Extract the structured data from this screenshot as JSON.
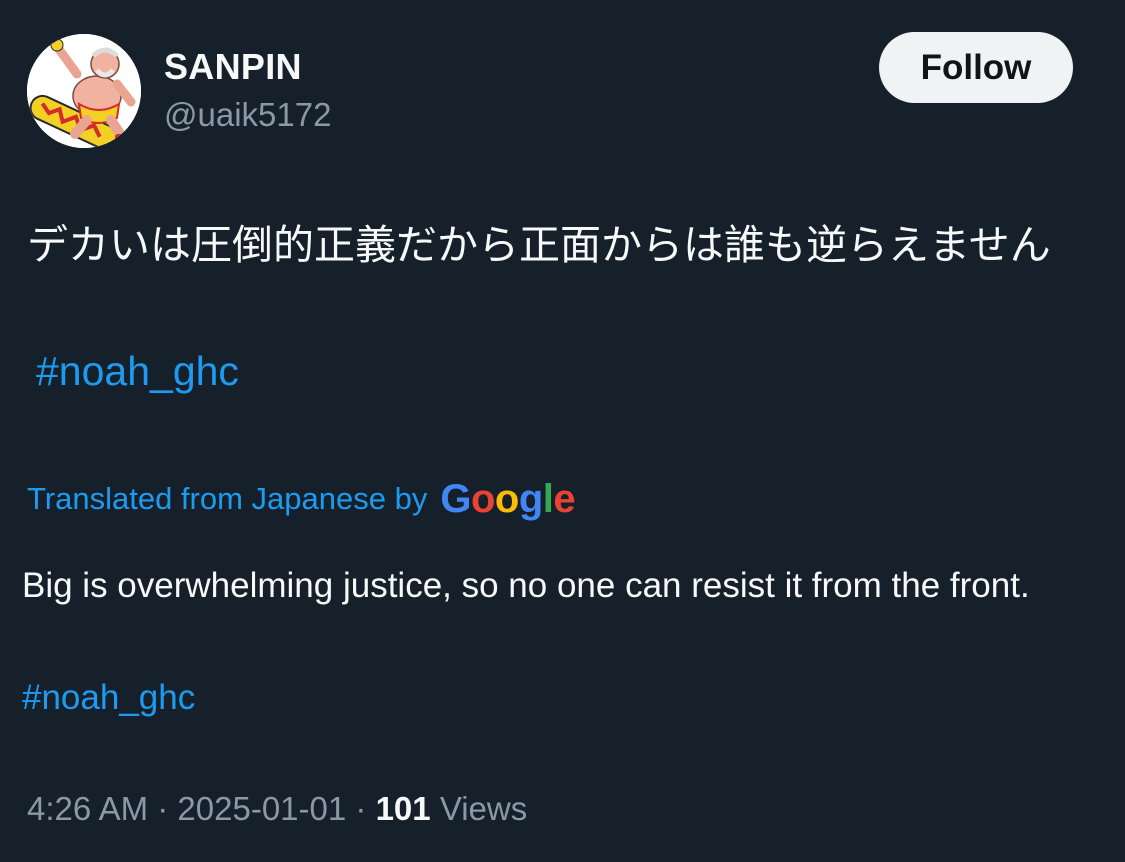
{
  "user": {
    "display_name": "SANPIN",
    "handle": "@uaik5172"
  },
  "follow_button": {
    "label": "Follow"
  },
  "tweet": {
    "original_text": "デカいは圧倒的正義だから正面からは誰も逆らえません",
    "original_hashtag": "#noah_ghc",
    "translation_label": "Translated from Japanese by",
    "translation_provider": [
      "G",
      "o",
      "o",
      "g",
      "l",
      "e"
    ],
    "translation_text": "Big is overwhelming justice, so no one can resist it from the front.",
    "translation_hashtag": "#noah_ghc"
  },
  "meta": {
    "time": "4:26 AM",
    "separator": "·",
    "date": "2025-01-01",
    "views_count": "101",
    "views_label": "Views"
  },
  "colors": {
    "background": "#15202b",
    "link": "#1d9bf0",
    "google": [
      "#4285f4",
      "#ea4335",
      "#fbbc05",
      "#4285f4",
      "#34a853",
      "#ea4335"
    ]
  },
  "icons": {
    "avatar": "wrestler-on-skateboard-avatar"
  }
}
